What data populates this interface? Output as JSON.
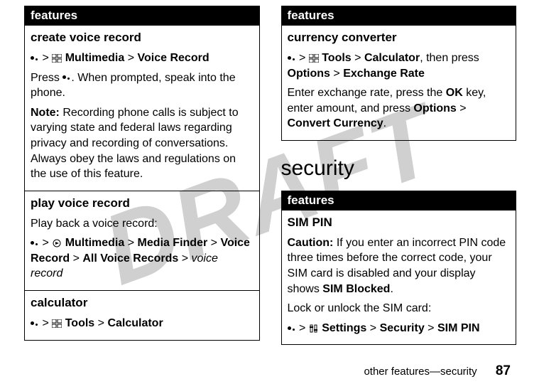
{
  "watermark": "DRAFT",
  "left": {
    "header": "features",
    "rows": [
      {
        "title": "create voice record",
        "path_parts": [
          "Multimedia",
          "Voice Record"
        ],
        "body1a": "Press ",
        "body1b": ". When prompted, speak into the phone.",
        "note_label": "Note:",
        "note_text": " Recording phone calls is subject to varying state and federal laws regarding privacy and recording of conversations. Always obey the laws and regulations on the use of this feature."
      },
      {
        "title": "play voice record",
        "body": "Play back a voice record:",
        "path_parts": [
          "Multimedia",
          "Media Finder",
          "Voice Record",
          "All Voice Records"
        ],
        "path_tail_italic": "voice record"
      },
      {
        "title": "calculator",
        "path_parts": [
          "Tools",
          "Calculator"
        ]
      }
    ]
  },
  "right_top": {
    "header": "features",
    "row": {
      "title": "currency converter",
      "path_parts": [
        "Tools",
        "Calculator"
      ],
      "then_text": ", then press ",
      "path_parts2": [
        "Options",
        "Exchange Rate"
      ],
      "body_a": "Enter exchange rate, press the ",
      "ok": "OK",
      "body_b": " key, enter amount, and press ",
      "opt": "Options",
      "conv": "Convert Currency",
      "body_c": "."
    }
  },
  "section_heading": "security",
  "right_bottom": {
    "header": "features",
    "row": {
      "title": "SIM PIN",
      "caution_label": "Caution:",
      "caution_a": " If you enter an incorrect PIN code three times before the correct code, your SIM card is disabled and your display shows ",
      "sim_blocked": "SIM Blocked",
      "caution_b": ".",
      "body": "Lock or unlock the SIM card:",
      "path_parts": [
        "Settings",
        "Security",
        "SIM PIN"
      ]
    }
  },
  "footer": {
    "text": "other features—security",
    "page": "87"
  }
}
